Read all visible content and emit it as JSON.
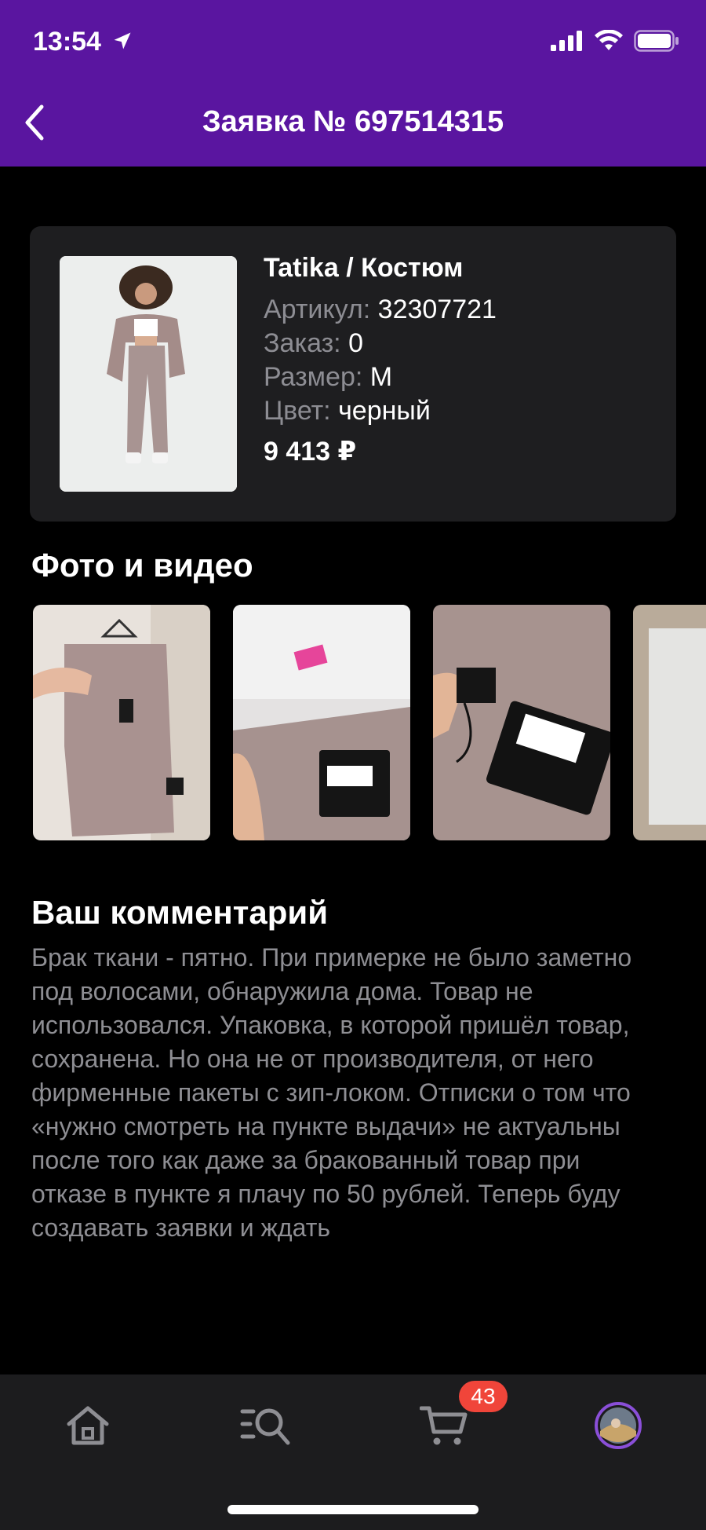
{
  "status": {
    "time": "13:54"
  },
  "header": {
    "title": "Заявка № 697514315"
  },
  "product": {
    "name": "Tatika / Костюм",
    "article_label": "Артикул:",
    "article_value": "32307721",
    "order_label": "Заказ:",
    "order_value": "0",
    "size_label": "Размер:",
    "size_value": "M",
    "color_label": "Цвет:",
    "color_value": "черный",
    "price": "9 413 ₽"
  },
  "media": {
    "title": "Фото и видео",
    "count_visible": 4
  },
  "comment": {
    "title": "Ваш комментарий",
    "text": "Брак ткани - пятно. При примерке не было заметно под волосами, обнаружила дома. Товар не использовался. Упаковка, в которой пришёл товар, сохранена. Но она не от производителя, от него фирменные пакеты с зип-локом. Отписки о том что «нужно смотреть на пункте выдачи» не актуальны после того как даже за бракованный товар при отказе в пункте я плачу по 50 рублей. Теперь буду создавать заявки и ждать"
  },
  "tabbar": {
    "items": [
      {
        "icon": "home-icon"
      },
      {
        "icon": "catalog-search-icon"
      },
      {
        "icon": "cart-icon"
      },
      {
        "icon": "profile-avatar"
      }
    ],
    "cart_badge": "43"
  },
  "colors": {
    "accent": "#5a15a0",
    "badge": "#f0453a",
    "card": "#1e1e20"
  }
}
